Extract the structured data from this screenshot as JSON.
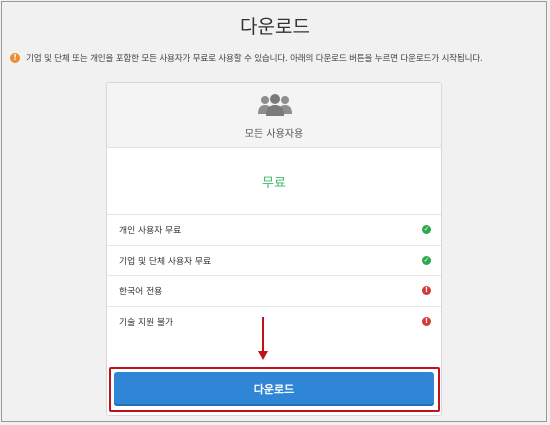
{
  "page": {
    "title": "다운로드",
    "notice": "기업 및 단체 또는 개인을 포함한 모든 사용자가 무료로 사용할 수 있습니다. 아래의 다운로드 버튼을 누르면 다운로드가 시작됩니다."
  },
  "card": {
    "icon": "users-icon",
    "plan_name": "모든 사용자용",
    "price": "무료",
    "features": [
      {
        "label": "개인 사용자 무료",
        "status": "check"
      },
      {
        "label": "기업 및 단체 사용자 무료",
        "status": "check"
      },
      {
        "label": "한국어 전용",
        "status": "exclamation"
      },
      {
        "label": "기술 지원 불가",
        "status": "exclamation"
      }
    ],
    "download_label": "다운로드"
  },
  "colors": {
    "accent_button": "#2f86d6",
    "price_green": "#3db86b",
    "check_green": "#2ea84f",
    "alert_red": "#d33b3b",
    "notice_orange": "#ef8a2f",
    "highlight_red": "#c0121a"
  }
}
